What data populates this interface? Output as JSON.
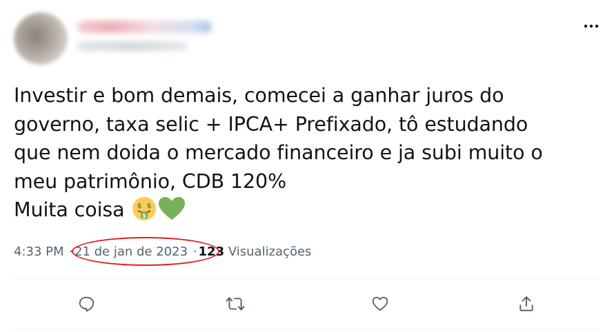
{
  "tweet": {
    "text_lines": [
      "Investir e bom demais, comecei a ganhar juros do",
      "governo, taxa selic + IPCA+ Prefixado, tô estudando",
      "que nem doida o mercado financeiro e ja subi muito o",
      "meu patrimônio, CDB 120%",
      "Muita coisa"
    ],
    "emojis": [
      "money-mouth-face-emoji",
      "green-heart-emoji"
    ],
    "time": "4:33 PM",
    "separator": "·",
    "date": "21 de jan de 2023",
    "views_count": "123",
    "views_label": "Visualizações"
  },
  "icons": {
    "more": "more-horizontal-icon",
    "reply": "reply-icon",
    "retweet": "retweet-icon",
    "like": "like-icon",
    "share": "share-icon"
  },
  "colors": {
    "text": "#0f1419",
    "secondary_text": "#536471",
    "icon": "#536471",
    "annotation": "#e01e1e",
    "heart_emoji": "#78b159",
    "money_face_emoji": "#fdcb58"
  }
}
